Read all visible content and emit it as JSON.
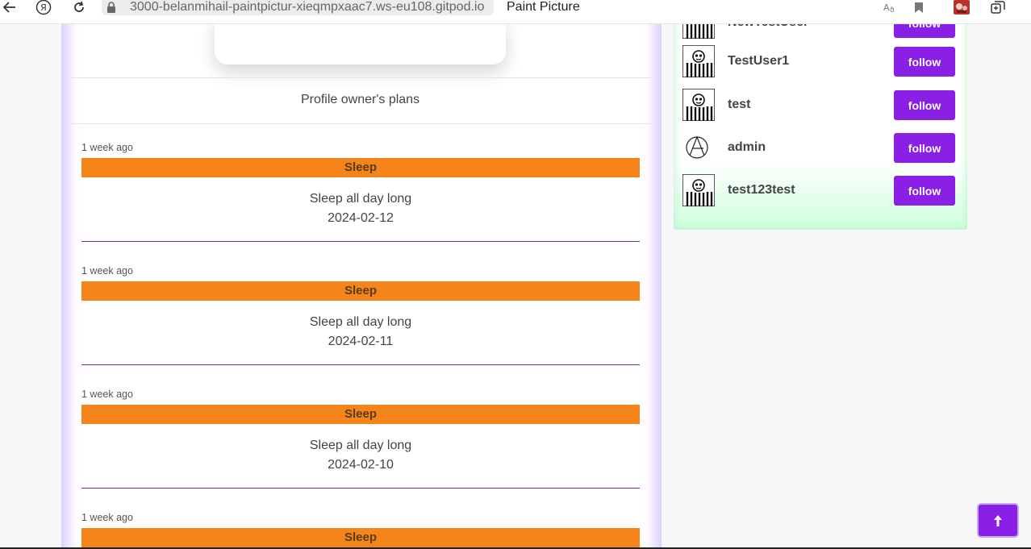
{
  "browser": {
    "url": "3000-belanmihail-paintpictur-xieqmpxaac7.ws-eu108.gitpod.io",
    "tab_title": "Paint Picture"
  },
  "profile": {
    "plans_heading": "Profile owner's plans"
  },
  "plans": [
    {
      "time": "1 week ago",
      "title": "Sleep",
      "description": "Sleep all day long",
      "date": "2024-02-12"
    },
    {
      "time": "1 week ago",
      "title": "Sleep",
      "description": "Sleep all day long",
      "date": "2024-02-11"
    },
    {
      "time": "1 week ago",
      "title": "Sleep",
      "description": "Sleep all day long",
      "date": "2024-02-10"
    },
    {
      "time": "1 week ago",
      "title": "Sleep",
      "description": "",
      "date": ""
    }
  ],
  "users": [
    {
      "name": "NewTestUser",
      "follow_label": "follow",
      "avatar": "default-avatar-icon"
    },
    {
      "name": "TestUser1",
      "follow_label": "follow",
      "avatar": "default-avatar-icon"
    },
    {
      "name": "test",
      "follow_label": "follow",
      "avatar": "default-avatar-icon"
    },
    {
      "name": "admin",
      "follow_label": "follow",
      "avatar": "anarchy-symbol-icon"
    },
    {
      "name": "test123test",
      "follow_label": "follow",
      "avatar": "default-avatar-icon"
    }
  ],
  "colors": {
    "accent": "#8a1fe6",
    "plan_bar": "#f5841b",
    "plan_divider": "#7a2b86",
    "panel_glow": "#ccffdd"
  },
  "icons": {
    "back": "arrow-left-icon",
    "yandex": "yandex-logo-icon",
    "reload": "reload-icon",
    "lock": "lock-icon",
    "translate": "translate-icon",
    "bookmark": "bookmark-icon",
    "extension": "extension-icon",
    "collections": "collections-icon",
    "scroll_top": "arrow-up-icon"
  }
}
